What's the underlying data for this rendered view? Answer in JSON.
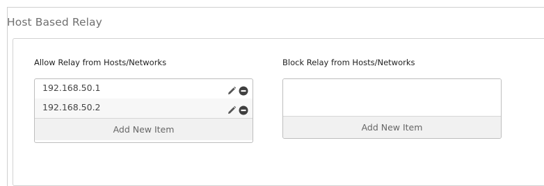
{
  "section": {
    "title": "Host Based Relay"
  },
  "allow": {
    "label": "Allow Relay from Hosts/Networks",
    "items": [
      {
        "value": "192.168.50.1"
      },
      {
        "value": "192.168.50.2"
      }
    ],
    "add_label": "Add New Item"
  },
  "block": {
    "label": "Block Relay from Hosts/Networks",
    "items": [],
    "add_label": "Add New Item"
  },
  "icons": {
    "edit": "pencil-icon",
    "remove": "minus-circle-icon"
  }
}
